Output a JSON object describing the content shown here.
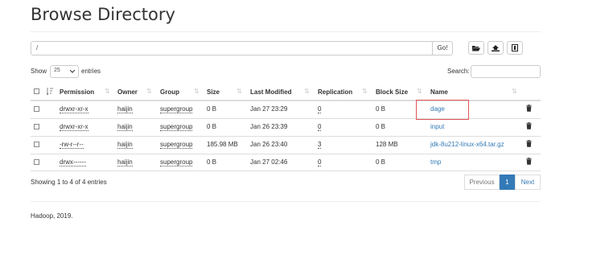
{
  "page": {
    "title": "Browse Directory"
  },
  "path": {
    "value": "/",
    "go_label": "Go!"
  },
  "toolbar": {
    "icons": [
      "folder-open-icon",
      "upload-icon",
      "columns-icon"
    ]
  },
  "length_menu": {
    "show_label": "Show",
    "selected": "25",
    "entries_label": "entries"
  },
  "search": {
    "label": "Search:",
    "value": ""
  },
  "table": {
    "headers": [
      "Permission",
      "Owner",
      "Group",
      "Size",
      "Last Modified",
      "Replication",
      "Block Size",
      "Name"
    ],
    "rows": [
      {
        "permission": "drwxr-xr-x",
        "owner": "haijin",
        "group": "supergroup",
        "size": "0 B",
        "modified": "Jan 27 23:29",
        "replication": "0",
        "block_size": "0 B",
        "name": "dage"
      },
      {
        "permission": "drwxr-xr-x",
        "owner": "haijin",
        "group": "supergroup",
        "size": "0 B",
        "modified": "Jan 26 23:39",
        "replication": "0",
        "block_size": "0 B",
        "name": "input"
      },
      {
        "permission": "-rw-r--r--",
        "owner": "haijin",
        "group": "supergroup",
        "size": "185.98 MB",
        "modified": "Jan 26 23:40",
        "replication": "3",
        "block_size": "128 MB",
        "name": "jdk-8u212-linux-x64.tar.gz"
      },
      {
        "permission": "drwx------",
        "owner": "haijin",
        "group": "supergroup",
        "size": "0 B",
        "modified": "Jan 27 02:46",
        "replication": "0",
        "block_size": "0 B",
        "name": "tmp"
      }
    ]
  },
  "info": {
    "text": "Showing 1 to 4 of 4 entries"
  },
  "pagination": {
    "previous": "Previous",
    "current": "1",
    "next": "Next"
  },
  "footer": {
    "text": "Hadoop, 2019."
  },
  "colors": {
    "link": "#337ab7",
    "highlight": "#e05555"
  }
}
